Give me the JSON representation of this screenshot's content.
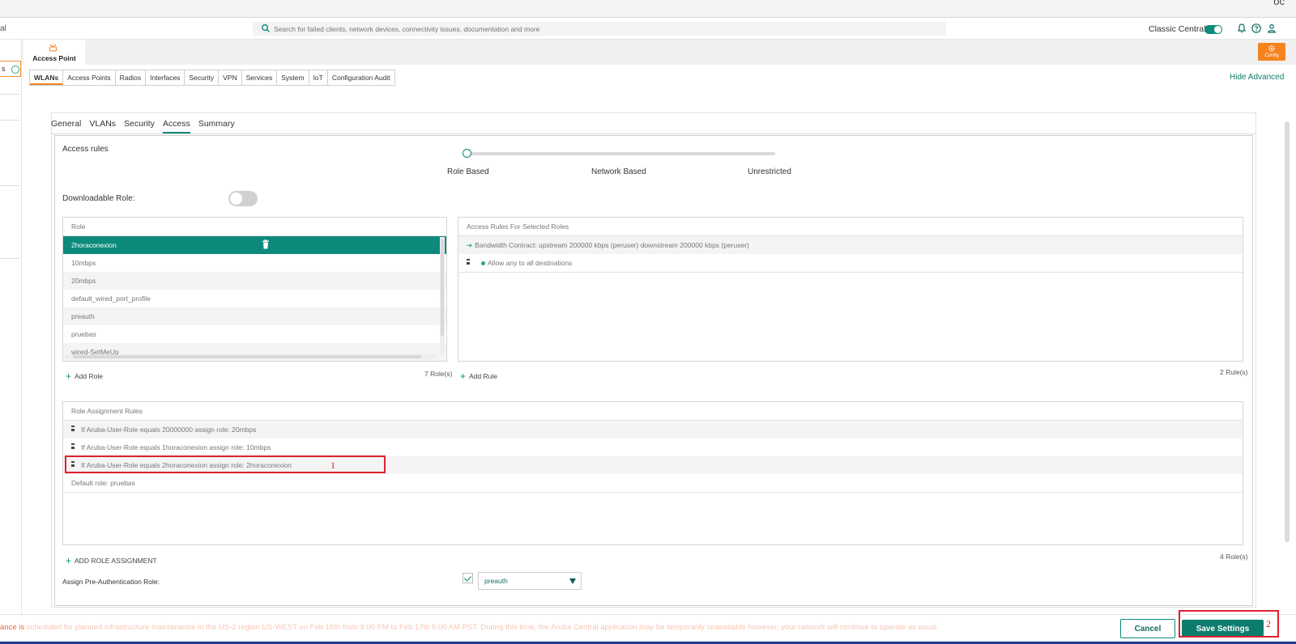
{
  "topbar": {
    "corner_glyph": "ос"
  },
  "header": {
    "left_fragment": "al",
    "search_placeholder": "Search for failed clients, network devices, connectivity issues, documentation and more",
    "classic_central_label": "Classic Central",
    "icons": [
      "bell-icon",
      "help-icon",
      "user-icon"
    ]
  },
  "sidebar": {
    "chip_fragment": "s"
  },
  "config_band": {
    "access_point_label": "Access Point",
    "config_label": "Config"
  },
  "subtabs": [
    "WLANs",
    "Access Points",
    "Radios",
    "Interfaces",
    "Security",
    "VPN",
    "Services",
    "System",
    "IoT",
    "Configuration Audit"
  ],
  "hide_advanced": "Hide Advanced",
  "wlan_tabs": [
    "General",
    "VLANs",
    "Security",
    "Access",
    "Summary"
  ],
  "access": {
    "access_rules_label": "Access rules",
    "slider_labels": [
      "Role Based",
      "Network Based",
      "Unrestricted"
    ],
    "slider_value": "Role Based",
    "downloadable_role_label": "Downloadable Role:",
    "role_header": "Role",
    "roles": [
      "2horaconexion",
      "10mbps",
      "20mbps",
      "default_wired_port_profile",
      "preauth",
      "pruebas",
      "wired-SetMeUp"
    ],
    "add_role": "Add Role",
    "roles_count": "7 Role(s)",
    "rules_header": "Access Rules For Selected Roles",
    "rules": [
      "Bandwidth Contract: upstream 200000 kbps (peruser) downstream 200000 kbps (peruser)",
      "Allow any to all destinations"
    ],
    "add_rule": "Add Rule",
    "rules_count": "2 Rule(s)",
    "assignment_header": "Role Assignment Rules",
    "assignments": [
      "If Aruba-User-Role equals 20000000 assign role: 20mbps",
      "If Aruba-User-Role equals 1horaconexion assign role: 10mbps",
      "If Aruba-User-Role equals 2horaconexion assign role: 2horaconexion",
      "Default role: pruebas"
    ],
    "add_role_assignment": "ADD ROLE ASSIGNMENT",
    "assignment_count": "4 Role(s)",
    "preauth_label": "Assign Pre-Authentication Role:",
    "preauth_value": "preauth"
  },
  "annotations": {
    "box1": "1",
    "box2": "2"
  },
  "footer": {
    "banner_lead": "ance is",
    "banner_rest": " scheduled for planned infrastructure maintenance in the US-2 region US-WEST on Feb 16th from 9:00 PM to Feb 17th 5:00 AM PST. During this time, the Aruba Central application may be temporarily unavailable however, your network will continue to operate as usual.",
    "cancel": "Cancel",
    "save": "Save Settings"
  }
}
